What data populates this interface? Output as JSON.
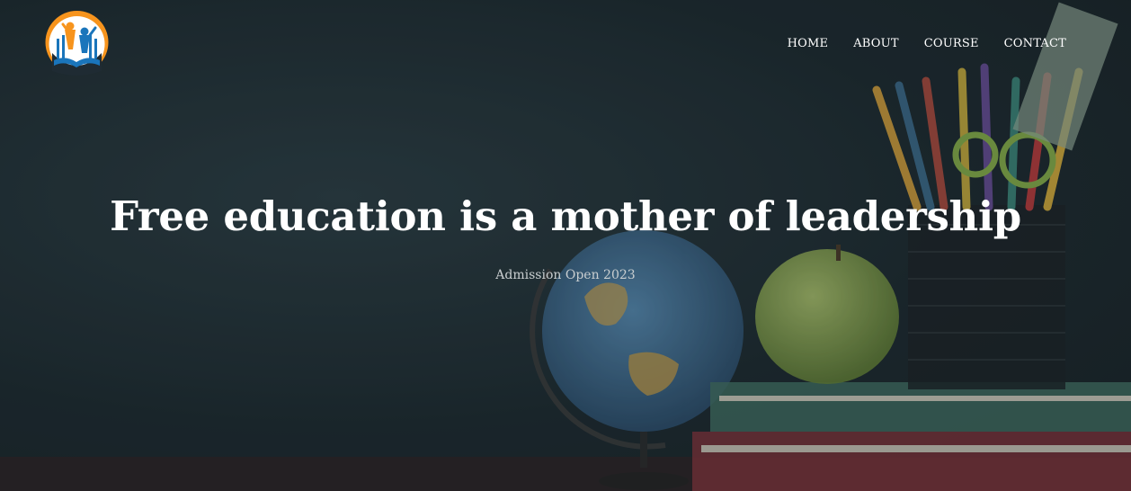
{
  "nav": {
    "items": [
      {
        "label": "HOME"
      },
      {
        "label": "ABOUT"
      },
      {
        "label": "COURSE"
      },
      {
        "label": "CONTACT"
      }
    ]
  },
  "hero": {
    "headline": "Free education is a mother of leadership",
    "subheadline": "Admission Open 2023"
  },
  "colors": {
    "background": "#1e2b30",
    "logo_orange": "#f7941d",
    "logo_blue": "#1a75bb",
    "text": "#ffffff"
  },
  "icons": {
    "logo": "school-book-logo-icon"
  }
}
